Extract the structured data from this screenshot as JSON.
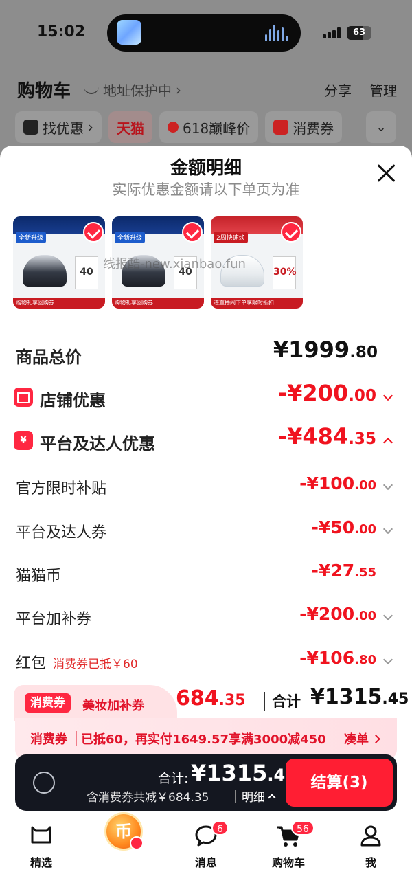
{
  "status_bar": {
    "time": "15:02",
    "battery": "63",
    "battery_level": 0.63
  },
  "page": {
    "title": "购物车",
    "address": "地址保护中",
    "share": "分享",
    "manage": "管理",
    "chips": [
      "找优惠",
      "天猫",
      "618巅峰价",
      "消费券"
    ]
  },
  "sheet": {
    "title": "金额明细",
    "subtitle": "实际优惠金额请以下单页为准",
    "watermark": "线报酷-new.xianbao.fun",
    "products": [
      {
        "tag": "全新升级",
        "box": "40",
        "footer": "购物礼享回购券"
      },
      {
        "tag": "全新升级",
        "box": "40",
        "footer": "购物礼享回购券"
      },
      {
        "tag": "2周快速焕",
        "box": "30%",
        "footer": "进直播间下单享限时折扣"
      }
    ],
    "rows": {
      "goods_total": {
        "label": "商品总价",
        "int": "¥1999",
        "dec": ".80"
      },
      "shop_discount": {
        "label": "店铺优惠",
        "int": "-¥200",
        "dec": ".00"
      },
      "platform_discount": {
        "label": "平台及达人优惠",
        "int": "-¥484",
        "dec": ".35"
      },
      "official_subsidy": {
        "label": "官方限时补贴",
        "int": "-¥100",
        "dec": ".00"
      },
      "platform_coupon": {
        "label": "平台及达人券",
        "int": "-¥50",
        "dec": ".00"
      },
      "cat_coin": {
        "label": "猫猫币",
        "int": "-¥27",
        "dec": ".55"
      },
      "extra_coupon": {
        "label": "平台加补券",
        "int": "-¥200",
        "dec": ".00"
      },
      "red_packet": {
        "label": "红包",
        "note": "消费券已抵￥60",
        "int": "-¥106",
        "dec": ".80"
      }
    },
    "promo": {
      "badge": "消费券",
      "text": "美妆加补券",
      "amount_int": "684",
      "amount_dec": ".35",
      "total_label": "合计",
      "total_int": "¥1315",
      "total_dec": ".45"
    },
    "coupon_bar": {
      "label": "消费券",
      "text": "已抵60，再实付1649.57享满3000减450",
      "action": "凑单"
    },
    "checkout": {
      "total_label": "合计:",
      "total_int": "¥1315",
      "total_dec": ".45",
      "saving": "含消费券共减￥684.35",
      "detail": "明细",
      "button": "结算(3)"
    }
  },
  "tabbar": {
    "items": [
      {
        "label": "精选"
      },
      {
        "label": "",
        "coin": "币"
      },
      {
        "label": "消息",
        "badge": "6"
      },
      {
        "label": "购物车",
        "badge": "56"
      },
      {
        "label": "我"
      }
    ]
  },
  "colors": {
    "accent_red": "#f0131f",
    "checkout_bg": "#141720",
    "button_red": "#ff1e33"
  }
}
